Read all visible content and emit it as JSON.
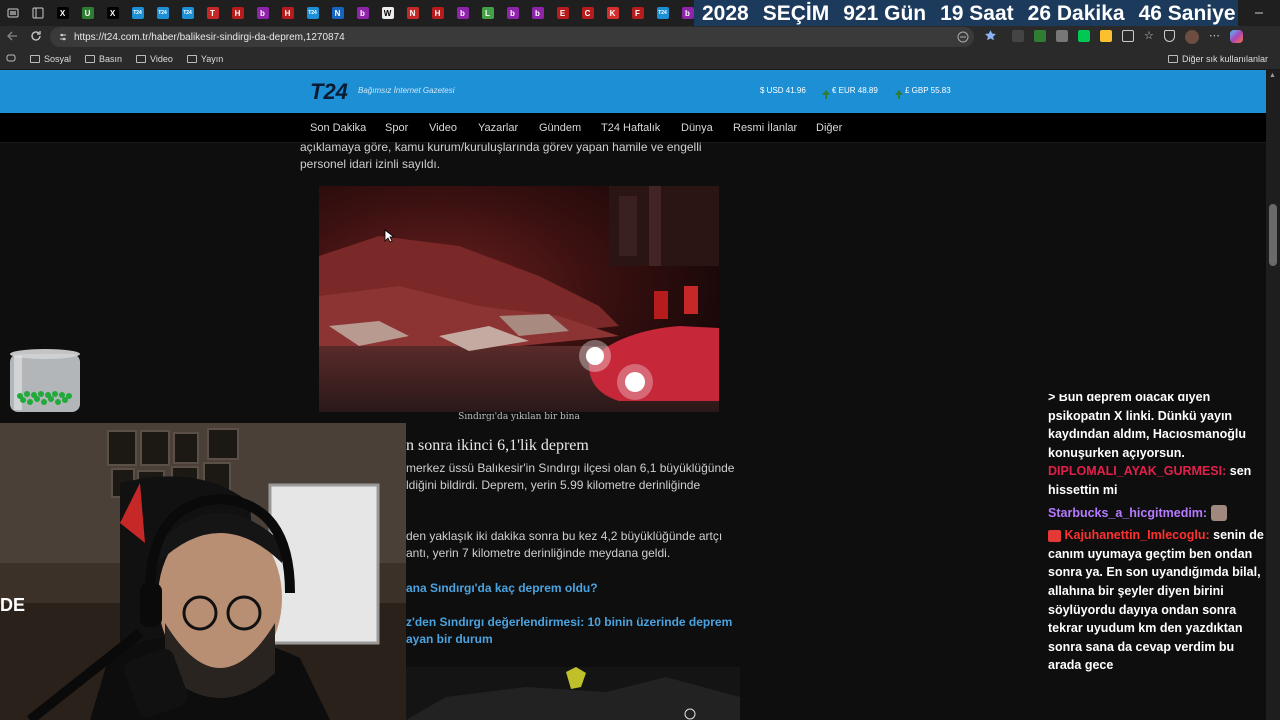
{
  "countdown": {
    "year": "2028",
    "event": "SEÇİM",
    "days": "921 Gün",
    "hours": "19 Saat",
    "minutes": "26 Dakika",
    "seconds": "46 Saniye",
    "background": "#1c3a5c"
  },
  "tabs": [
    {
      "icon": "x-icon",
      "label": "X",
      "color": "#000000"
    },
    {
      "icon": "u-icon",
      "label": "U",
      "color": "#2e7d32"
    },
    {
      "icon": "x-icon",
      "label": "X",
      "color": "#000000"
    },
    {
      "icon": "t24-icon",
      "label": "T24",
      "color": "#1d8fd4"
    },
    {
      "icon": "t24-icon",
      "label": "T24",
      "color": "#1d8fd4"
    },
    {
      "icon": "t24-icon",
      "label": "T24",
      "color": "#1d8fd4"
    },
    {
      "icon": "t-icon",
      "label": "T",
      "color": "#c62828"
    },
    {
      "icon": "news-icon",
      "label": "H",
      "color": "#b71c1c"
    },
    {
      "icon": "b-icon",
      "label": "b",
      "color": "#8e24aa"
    },
    {
      "icon": "news-icon",
      "label": "H",
      "color": "#b71c1c"
    },
    {
      "icon": "t24-icon",
      "label": "T24",
      "color": "#1d8fd4"
    },
    {
      "icon": "news-icon",
      "label": "N",
      "color": "#1565c0"
    },
    {
      "icon": "b-icon",
      "label": "b",
      "color": "#8e24aa"
    },
    {
      "icon": "doc-icon",
      "label": "W",
      "color": "#eeeeee"
    },
    {
      "icon": "news-icon",
      "label": "N",
      "color": "#c62828"
    },
    {
      "icon": "news-icon",
      "label": "H",
      "color": "#b71c1c"
    },
    {
      "icon": "b-icon",
      "label": "b",
      "color": "#8e24aa"
    },
    {
      "icon": "leaf-icon",
      "label": "L",
      "color": "#43a047"
    },
    {
      "icon": "b-icon",
      "label": "b",
      "color": "#8e24aa"
    },
    {
      "icon": "b-icon",
      "label": "b",
      "color": "#8e24aa"
    },
    {
      "icon": "news-icon",
      "label": "E",
      "color": "#b71c1c"
    },
    {
      "icon": "news-icon",
      "label": "C",
      "color": "#b71c1c"
    },
    {
      "icon": "k-icon",
      "label": "K",
      "color": "#d32f2f"
    },
    {
      "icon": "news-icon",
      "label": "F",
      "color": "#b71c1c"
    },
    {
      "icon": "t24-icon",
      "label": "T24",
      "color": "#1d8fd4"
    },
    {
      "icon": "b-icon",
      "label": "b",
      "color": "#8e24aa"
    }
  ],
  "address_bar": {
    "url": "https://t24.com.tr/haber/balikesir-sindirgi-da-deprem,1270874"
  },
  "bookmarks": {
    "items": [
      "Sosyal",
      "Basın",
      "Video",
      "Yayın"
    ],
    "other": "Diğer sık kullanılanlar"
  },
  "site": {
    "logo": "T24",
    "tagline": "Bağımsız İnternet Gazetesi",
    "rates": [
      {
        "label": "$ USD 41.96"
      },
      {
        "label": "€ EUR 48.89"
      },
      {
        "label": "£ GBP 55.83"
      }
    ],
    "nav": [
      "Son Dakika",
      "Spor",
      "Video",
      "Yazarlar",
      "Gündem",
      "T24 Haftalık",
      "Dünya",
      "Resmi İlanlar",
      "Diğer"
    ],
    "accent": "#1d8fd4"
  },
  "article": {
    "para_top_1": "açıklamaya göre, kamu kurum/kuruluşlarında görev yapan hamile ve engelli",
    "para_top_2": "personel idari izinli sayıldı.",
    "caption": "Sındırgı'da yıkılan bir bina",
    "subheading": "n sonra ikinci 6,1'lik deprem",
    "para2_line1": "merkez üssü Balıkesir'in Sındırgı ilçesi olan 6,1 büyüklüğünde",
    "para2_line2": "ldiğini bildirdi. Deprem, yerin 5.99 kilometre derinliğinde",
    "para3_line1": "den yaklaşık iki dakika sonra bu kez 4,2 büyüklüğünde artçı",
    "para3_line2": "antı, yerin 7 kilometre derinliğinde meydana geldi.",
    "link1": "ana Sındırgı'da kaç deprem oldu?",
    "link2_line1": "z'den Sındırgı değerlendirmesi: 10 binin üzerinde deprem",
    "link2_line2": "ayan bir durum"
  },
  "webcam": {
    "wall_text": "DE"
  },
  "chat": [
    {
      "user": "",
      "user_color": "#ffffff",
      "text": "> Bun deprem olacak diyen psikopatın X linki. Dünkü yayın kaydından aldım, Hacıosmanoğlu konuşurken açıyorsun."
    },
    {
      "user": "DIPLOMALI_AYAK_GURMESI:",
      "user_color": "#e0204b",
      "text": "sen hissettin mi"
    },
    {
      "user": "Starbucks_a_hicgitmedim:",
      "user_color": "#b57bff",
      "text": ""
    },
    {
      "user": "Kajuhanettin_Imlecoglu:",
      "user_color": "#ff3030",
      "text": "senin de canım uyumaya geçtim ben ondan sonra ya. En son uyandığımda bilal, allahına bir şeyler diyen birini söylüyordu dayıya ondan sonra tekrar uyudum km den yazdıktan sonra sana da cevap verdim bu arada gece"
    }
  ]
}
